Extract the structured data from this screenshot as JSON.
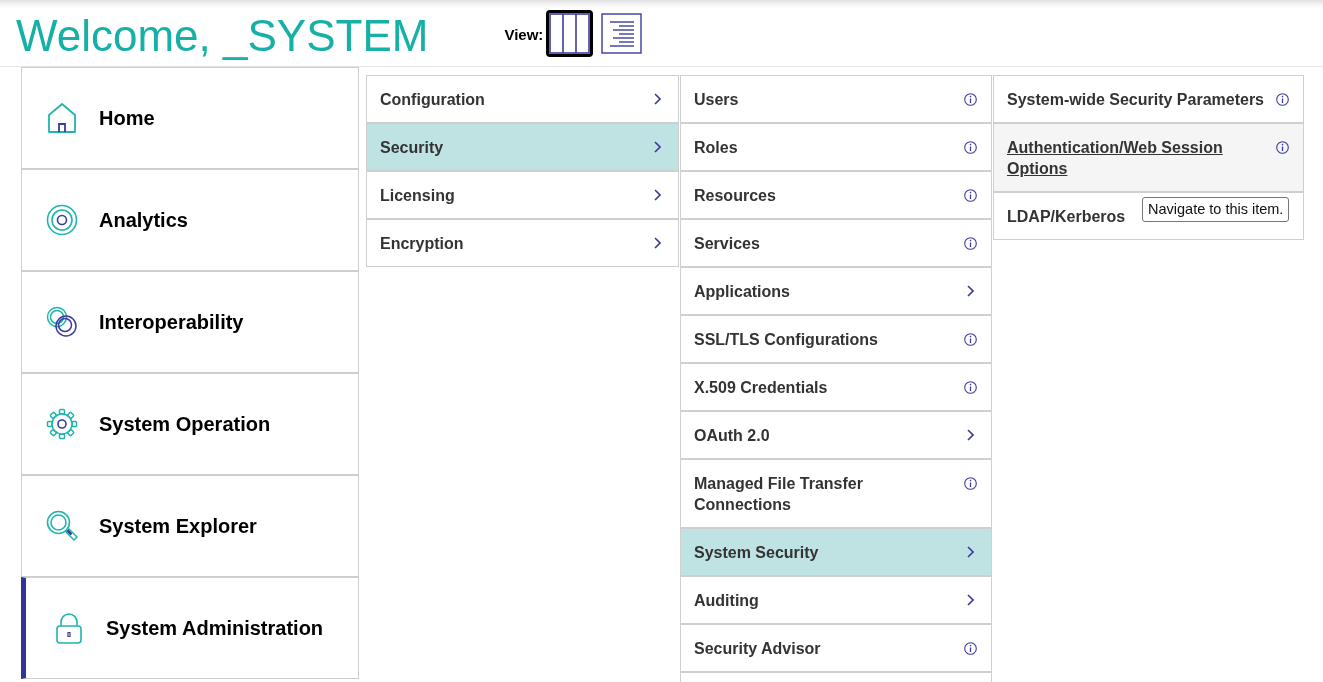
{
  "header": {
    "title": "Welcome, _SYSTEM",
    "view_label": "View:",
    "view_buttons": [
      {
        "kind": "columns",
        "selected": true
      },
      {
        "kind": "list",
        "selected": false
      }
    ]
  },
  "sidebar": {
    "items": [
      {
        "label": "Home",
        "selected": false
      },
      {
        "label": "Analytics",
        "selected": false
      },
      {
        "label": "Interoperability",
        "selected": false
      },
      {
        "label": "System Operation",
        "selected": false
      },
      {
        "label": "System Explorer",
        "selected": false
      },
      {
        "label": "System Administration",
        "selected": true
      }
    ]
  },
  "columns": [
    {
      "items": [
        {
          "label": "Configuration",
          "kind": "submenu",
          "selected": false
        },
        {
          "label": "Security",
          "kind": "submenu",
          "selected": true
        },
        {
          "label": "Licensing",
          "kind": "submenu",
          "selected": false
        },
        {
          "label": "Encryption",
          "kind": "submenu",
          "selected": false
        }
      ]
    },
    {
      "items": [
        {
          "label": "Users",
          "kind": "info",
          "selected": false
        },
        {
          "label": "Roles",
          "kind": "info",
          "selected": false
        },
        {
          "label": "Resources",
          "kind": "info",
          "selected": false
        },
        {
          "label": "Services",
          "kind": "info",
          "selected": false
        },
        {
          "label": "Applications",
          "kind": "submenu",
          "selected": false
        },
        {
          "label": "SSL/TLS Configurations",
          "kind": "info",
          "selected": false
        },
        {
          "label": "X.509 Credentials",
          "kind": "info",
          "selected": false
        },
        {
          "label": "OAuth 2.0",
          "kind": "submenu",
          "selected": false
        },
        {
          "label": "Managed File Transfer Connections",
          "kind": "info",
          "selected": false
        },
        {
          "label": "System Security",
          "kind": "submenu",
          "selected": true
        },
        {
          "label": "Auditing",
          "kind": "submenu",
          "selected": false
        },
        {
          "label": "Security Advisor",
          "kind": "info",
          "selected": false
        }
      ]
    },
    {
      "items": [
        {
          "label": "System-wide Security Parameters",
          "kind": "info",
          "selected": false,
          "hovered": false
        },
        {
          "label": "Authentication/Web Session Options",
          "kind": "info",
          "selected": false,
          "hovered": true
        },
        {
          "label": "LDAP/Kerberos",
          "selected": false,
          "hovered": false,
          "tooltip": "Navigate to this item."
        }
      ]
    }
  ]
}
